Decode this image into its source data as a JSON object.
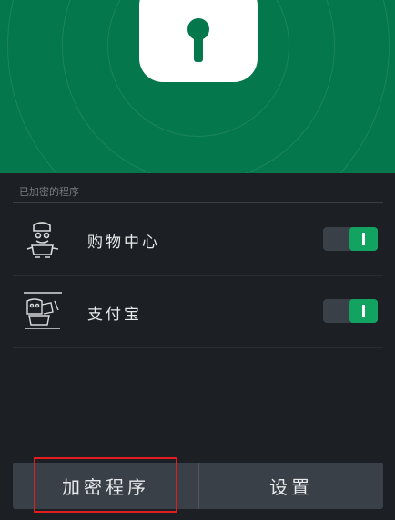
{
  "header": {
    "accent_color": "#04774c",
    "icon": "lock-icon"
  },
  "section": {
    "label": "已加密的程序"
  },
  "apps": [
    {
      "name": "购物中心",
      "icon": "shopping-character-icon",
      "locked": true
    },
    {
      "name": "支付宝",
      "icon": "alipay-character-icon",
      "locked": true
    }
  ],
  "bottom_bar": {
    "encrypt_label": "加密程序",
    "settings_label": "设置"
  },
  "colors": {
    "toggle_on": "#11a35f",
    "highlight": "#e11d1d"
  }
}
